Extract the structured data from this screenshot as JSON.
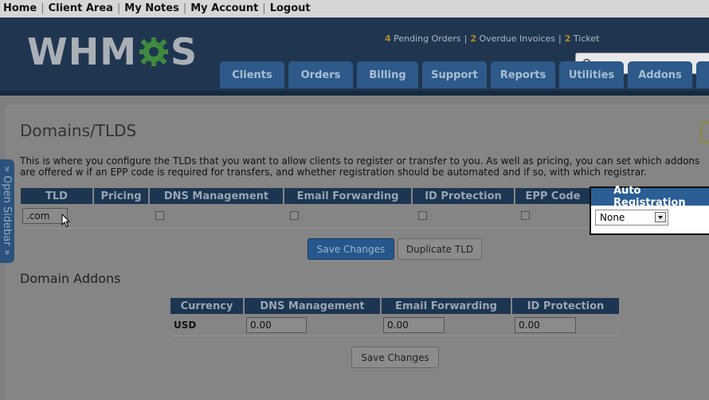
{
  "topnav": {
    "items": [
      "Home",
      "Client Area",
      "My Notes",
      "My Account",
      "Logout"
    ]
  },
  "logo": {
    "text_before": "WHM",
    "text_after": "S"
  },
  "alerts": {
    "pending_count": "4",
    "pending_label": "Pending Orders",
    "overdue_count": "2",
    "overdue_label": "Overdue Invoices",
    "tickets_count": "2",
    "tickets_label": "Ticket"
  },
  "tabs": [
    "Clients",
    "Orders",
    "Billing",
    "Support",
    "Reports",
    "Utilities",
    "Addons"
  ],
  "sidebar": {
    "label": "» Open Sidebar »"
  },
  "page": {
    "title": "Domains/TLDS",
    "description": "This is where you configure the TLDs that you want to allow clients to register or transfer to you. As well as pricing, you can set which addons are offered w if an EPP code is required for transfers, and whether registration should be automated and if so, with which registrar."
  },
  "tld_table": {
    "headers": [
      "TLD",
      "Pricing",
      "DNS Management",
      "Email Forwarding",
      "ID Protection",
      "EPP Code",
      "Auto Registration"
    ],
    "row": {
      "tld": ".com",
      "auto_registration": "None"
    }
  },
  "buttons": {
    "save": "Save Changes",
    "duplicate": "Duplicate TLD",
    "save2": "Save Changes"
  },
  "addons": {
    "title": "Domain Addons",
    "headers": [
      "Currency",
      "DNS Management",
      "Email Forwarding",
      "ID Protection"
    ],
    "row": {
      "currency": "USD",
      "dns": "0.00",
      "email": "0.00",
      "id": "0.00"
    }
  },
  "colors": {
    "accent": "#2a5e95",
    "header_bg": "#203650",
    "alert_num": "#b18a24"
  }
}
